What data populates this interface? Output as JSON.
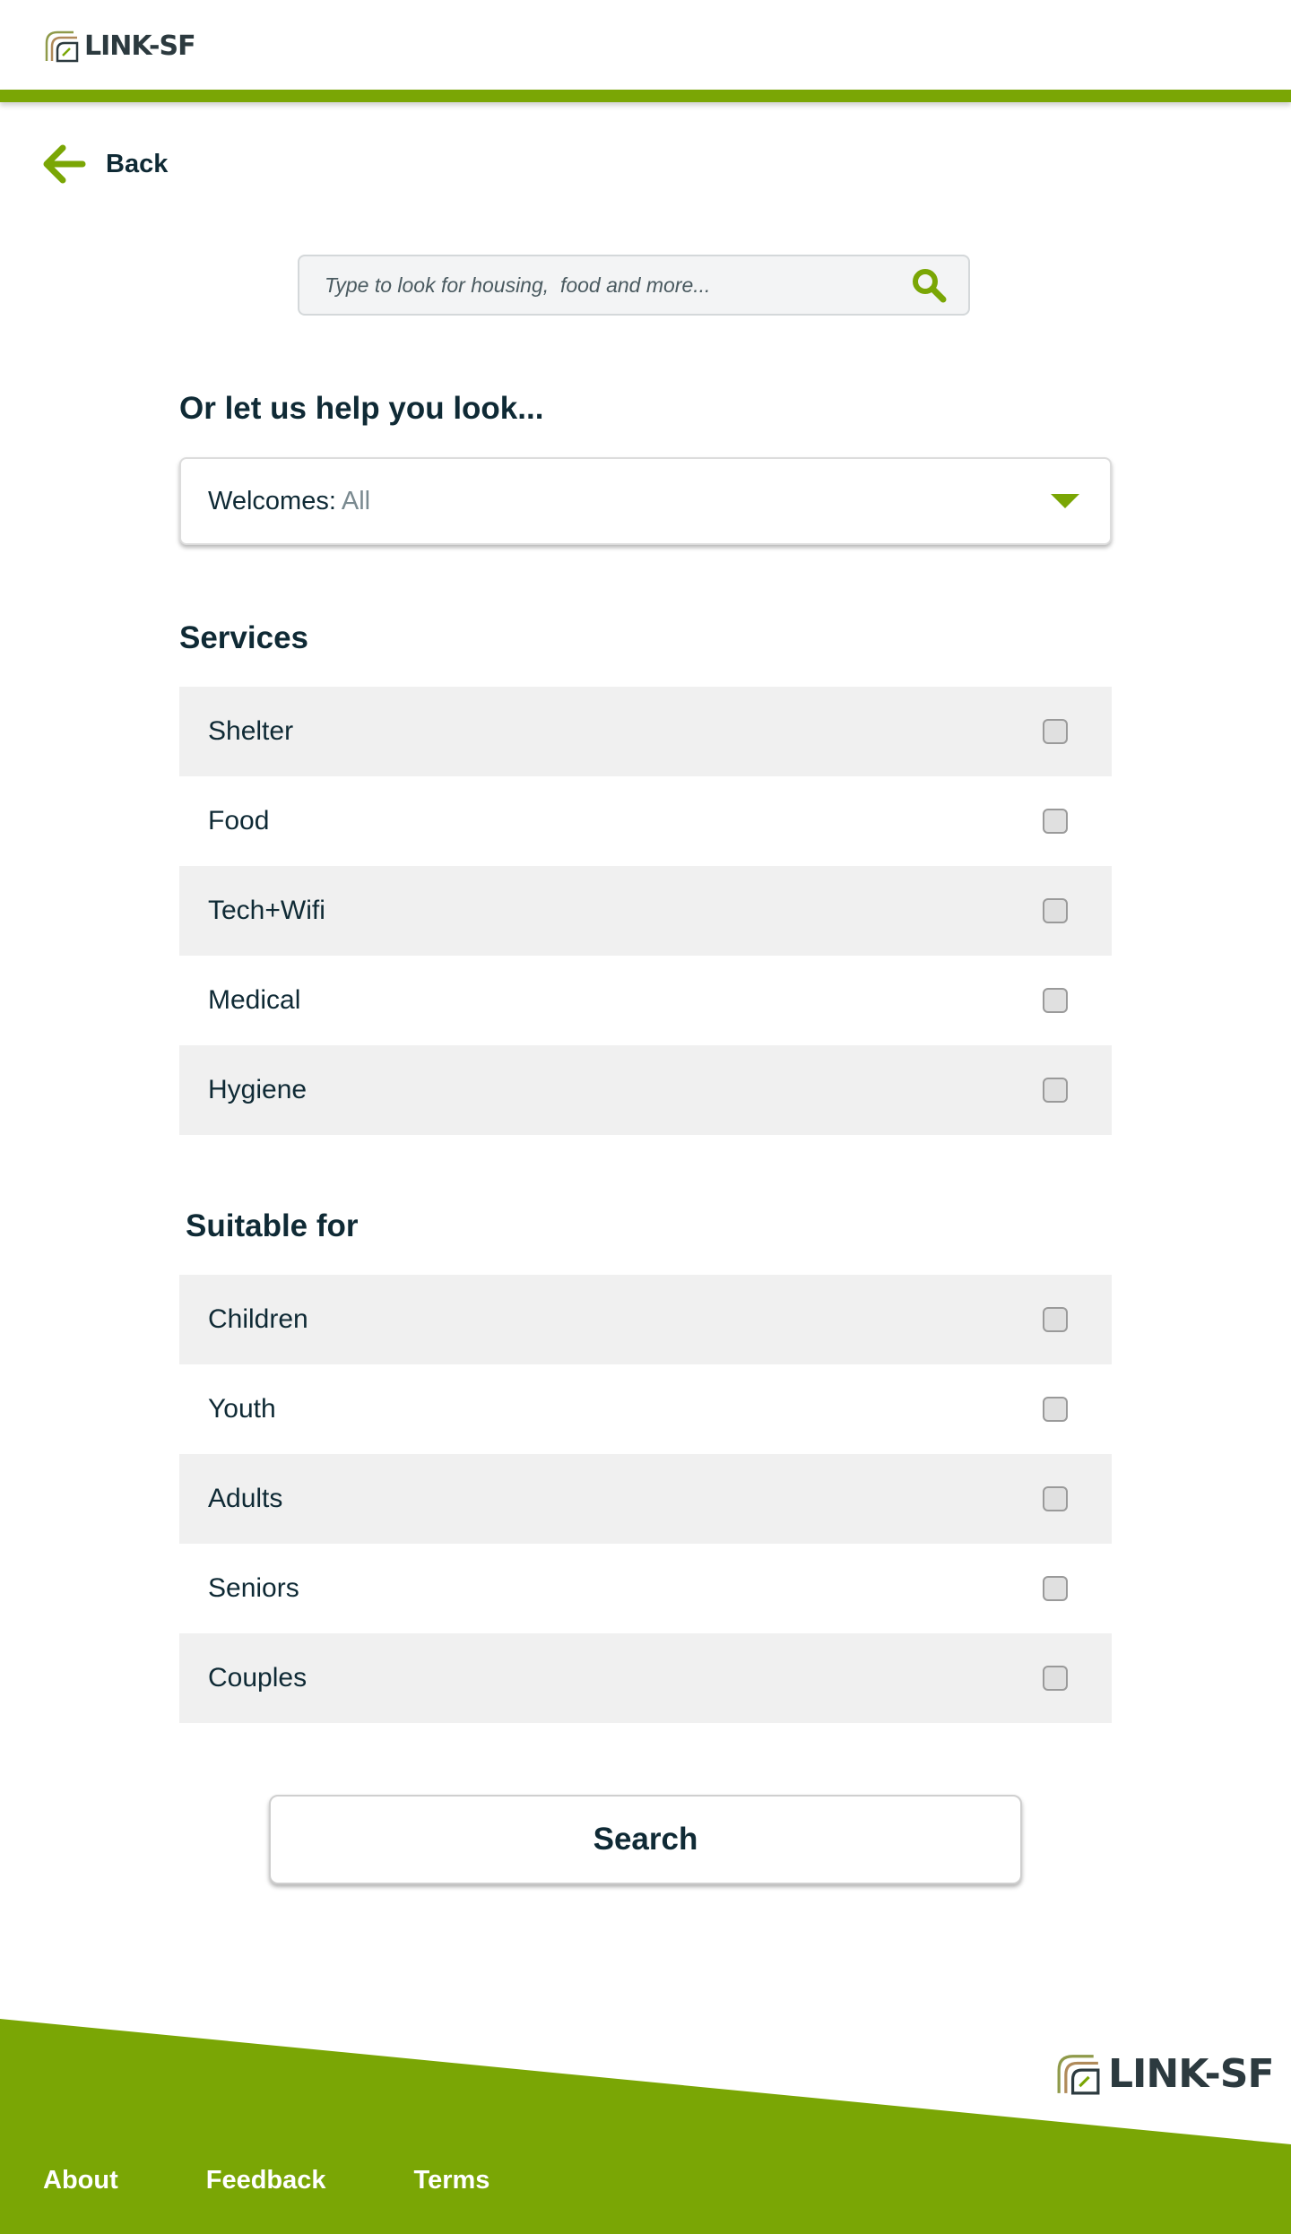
{
  "header": {
    "logo_text": "LINK-SF"
  },
  "back": {
    "label": "Back"
  },
  "search": {
    "placeholder": "Type to look for housing,  food and more..."
  },
  "help": {
    "title": "Or let us help you look..."
  },
  "welcomes": {
    "label": "Welcomes:",
    "value": "All"
  },
  "services": {
    "title": "Services",
    "items": [
      {
        "label": "Shelter",
        "checked": false
      },
      {
        "label": "Food",
        "checked": false
      },
      {
        "label": "Tech+Wifi",
        "checked": false
      },
      {
        "label": "Medical",
        "checked": false
      },
      {
        "label": "Hygiene",
        "checked": false
      }
    ]
  },
  "suitable": {
    "title": "Suitable for",
    "items": [
      {
        "label": "Children",
        "checked": false
      },
      {
        "label": "Youth",
        "checked": false
      },
      {
        "label": "Adults",
        "checked": false
      },
      {
        "label": "Seniors",
        "checked": false
      },
      {
        "label": "Couples",
        "checked": false
      }
    ]
  },
  "search_button": {
    "label": "Search"
  },
  "footer": {
    "logo_text": "LINK-SF",
    "links": [
      "About",
      "Feedback",
      "Terms"
    ]
  },
  "colors": {
    "brand_green": "#7aa605",
    "text_dark": "#0f2a35",
    "row_alt": "#f0f0f0"
  },
  "icons": {
    "back": "arrow-left-icon",
    "search": "magnifier-icon",
    "dropdown": "caret-down-icon",
    "logo": "link-sf-logo-icon"
  }
}
